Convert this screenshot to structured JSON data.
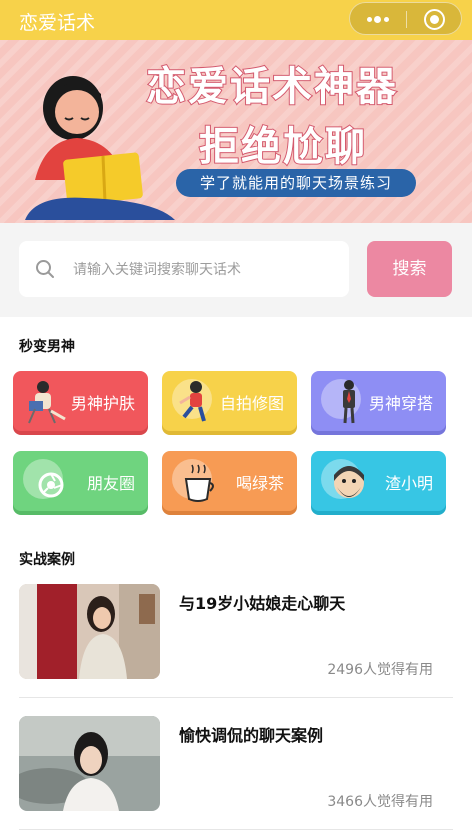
{
  "app": {
    "title": "恋爱话术"
  },
  "capsule": {
    "more_icon": "more-dots-icon",
    "close_icon": "target-icon"
  },
  "banner": {
    "headline_1": "恋爱话术神器",
    "headline_2": "拒绝尬聊",
    "tagline": "学了就能用的聊天场景练习"
  },
  "search": {
    "placeholder": "请输入关键词搜索聊天话术",
    "button_label": "搜索",
    "icon": "search-icon"
  },
  "colors": {
    "topbar": "#f7d24a",
    "search_button": "#ec88a2",
    "banner_bg": "#f7c6c0"
  },
  "categories": {
    "title": "秒变男神",
    "items": [
      {
        "label": "男神护肤",
        "icon": "man-reading-icon",
        "color": "#f1575c"
      },
      {
        "label": "自拍修图",
        "icon": "kneeling-man-icon",
        "color": "#f7d24a"
      },
      {
        "label": "男神穿搭",
        "icon": "suit-man-icon",
        "color": "#8e8ef4"
      },
      {
        "label": "朋友圈",
        "icon": "camera-shutter-icon",
        "color": "#6fd47f"
      },
      {
        "label": "喝绿茶",
        "icon": "tea-cup-icon",
        "color": "#f79b54"
      },
      {
        "label": "渣小明",
        "icon": "bearded-man-icon",
        "color": "#37c6e4"
      }
    ]
  },
  "cases": {
    "title": "实战案例",
    "items": [
      {
        "title": "与19岁小姑娘走心聊天",
        "likes": "2496人觉得有用",
        "thumb": "girl-photo"
      },
      {
        "title": "愉快调侃的聊天案例",
        "likes": "3466人觉得有用",
        "thumb": "woman-photo"
      }
    ]
  }
}
